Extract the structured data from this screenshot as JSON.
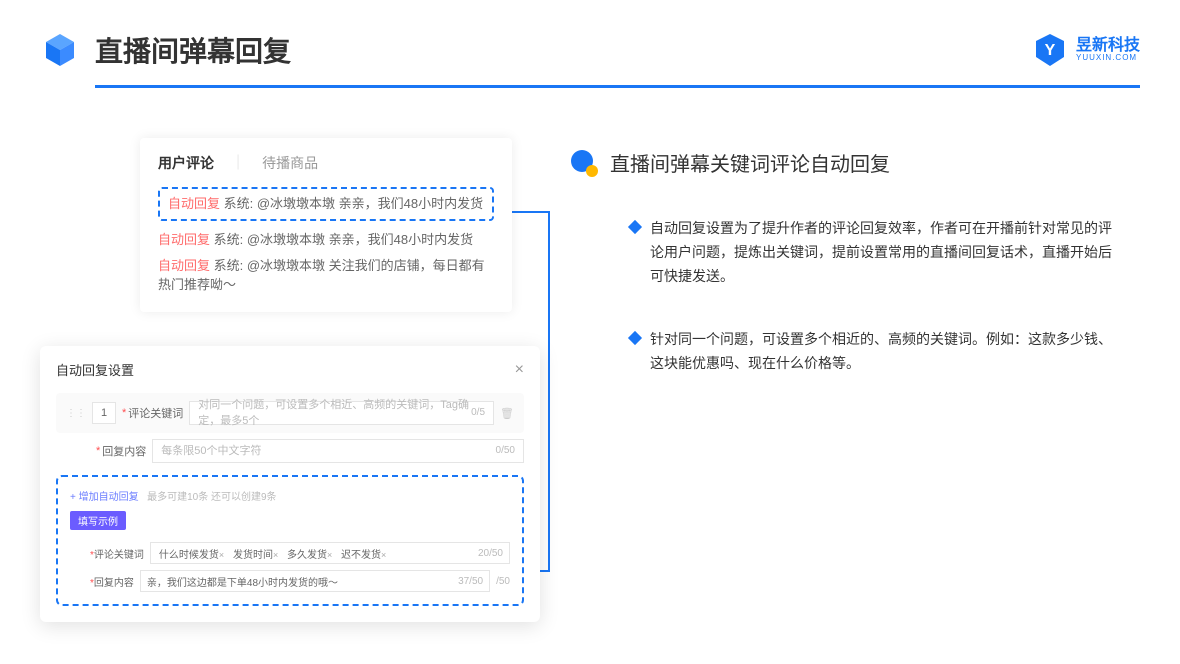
{
  "header": {
    "title": "直播间弹幕回复",
    "brand_cn": "昱新科技",
    "brand_en": "YUUXIN.COM"
  },
  "comment_panel": {
    "tab_active": "用户评论",
    "tab_other": "待播商品",
    "highlighted": {
      "tag": "自动回复",
      "text": " 系统: @冰墩墩本墩 亲亲，我们48小时内发货"
    },
    "rows": [
      {
        "tag": "自动回复",
        "text": " 系统: @冰墩墩本墩 亲亲，我们48小时内发货"
      },
      {
        "tag": "自动回复",
        "text": " 系统: @冰墩墩本墩 关注我们的店铺，每日都有热门推荐呦～"
      }
    ]
  },
  "settings_panel": {
    "title": "自动回复设置",
    "close": "×",
    "num": "1",
    "label_keyword": "评论关键词",
    "input_keyword_ph": "对同一个问题，可设置多个相近、高频的关键词，Tag确定，最多5个",
    "count_keyword": "0/5",
    "label_content": "回复内容",
    "input_content_ph": "每条限50个中文字符",
    "count_content": "0/50",
    "add_link": "+ 增加自动回复",
    "add_note": "最多可建10条 还可以创建9条",
    "badge": "填写示例",
    "ex_label_kw": "评论关键词",
    "ex_tags": [
      "什么时候发货",
      "发货时间",
      "多久发货",
      "迟不发货"
    ],
    "ex_kw_count": "20/50",
    "ex_label_ct": "回复内容",
    "ex_content": "亲，我们这边都是下单48小时内发货的哦～",
    "ex_ct_count": "37/50",
    "outer_count": "/50"
  },
  "right": {
    "section_title": "直播间弹幕关键词评论自动回复",
    "bullets": [
      "自动回复设置为了提升作者的评论回复效率，作者可在开播前针对常见的评论用户问题，提炼出关键词，提前设置常用的直播间回复话术，直播开始后可快捷发送。",
      "针对同一个问题，可设置多个相近的、高频的关键词。例如：这款多少钱、这块能优惠吗、现在什么价格等。"
    ]
  }
}
